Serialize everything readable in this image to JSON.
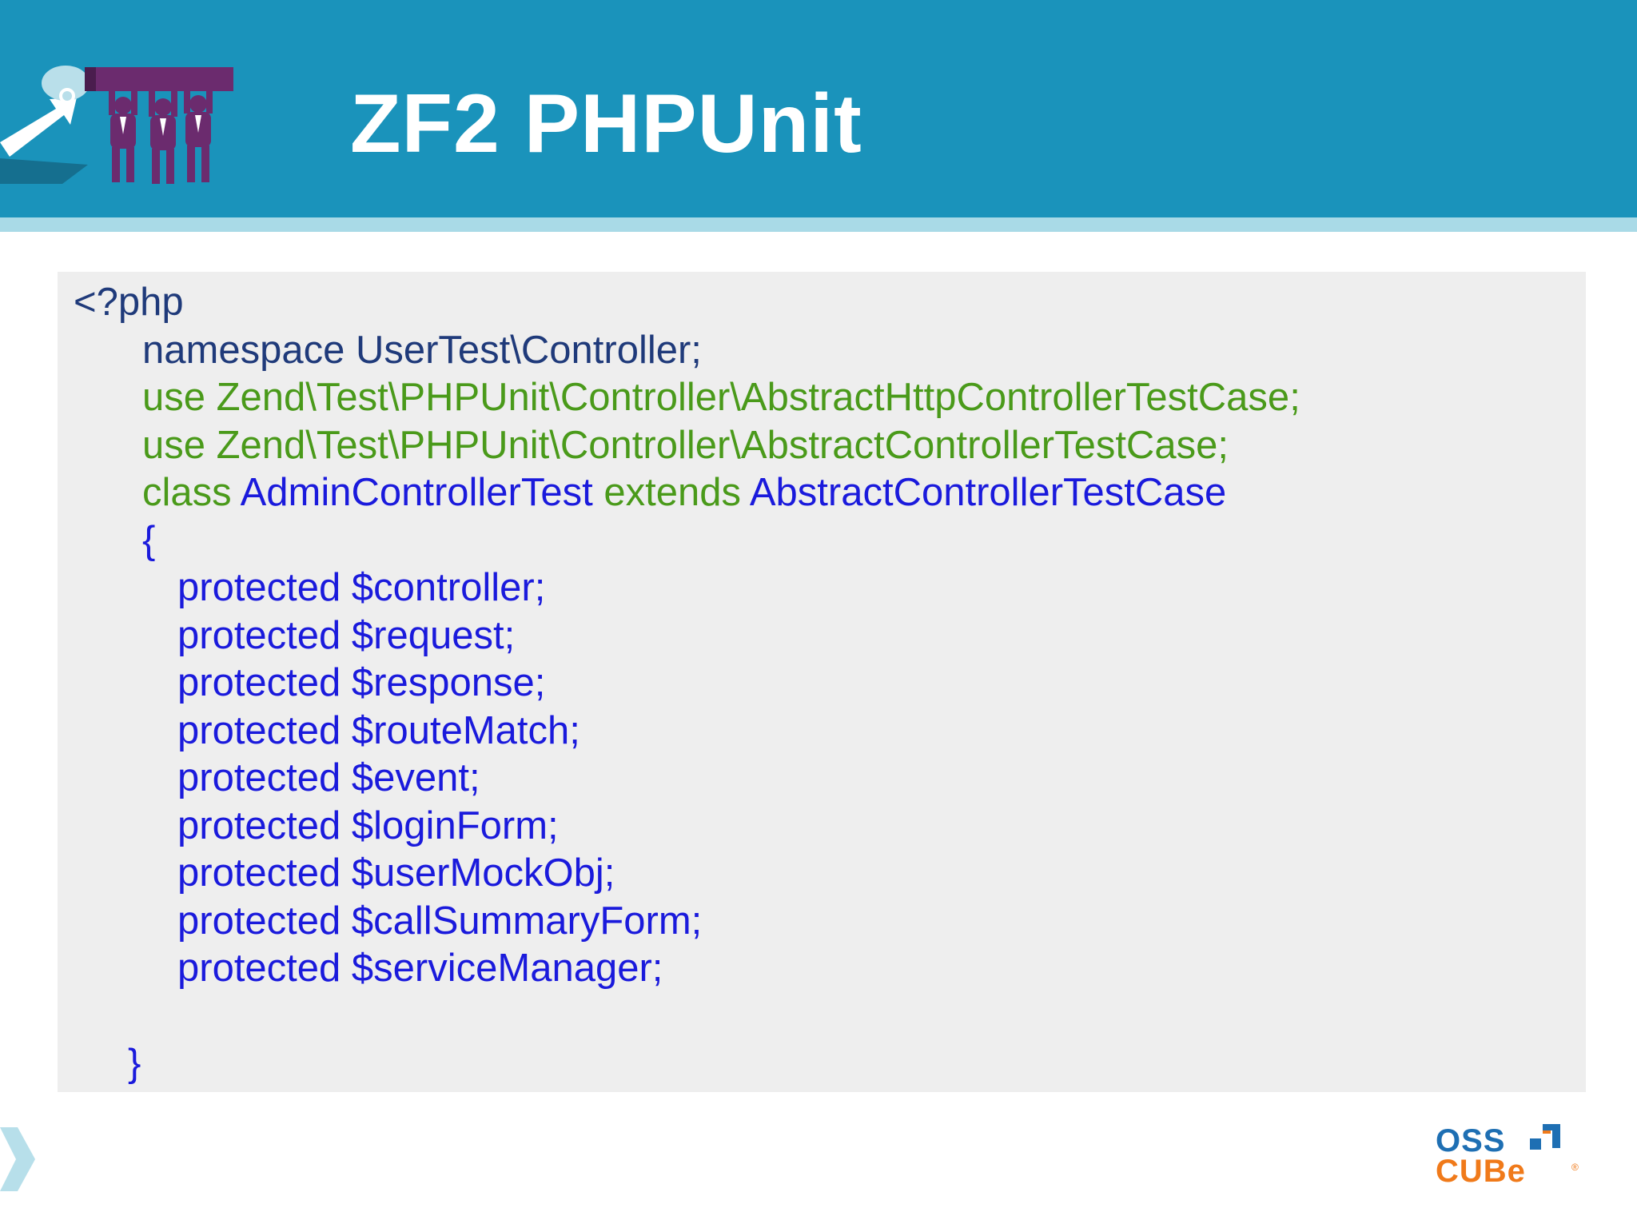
{
  "slide": {
    "title": "ZF2 PHPUnit"
  },
  "logo": {
    "alt": "OSS CUBE"
  },
  "code": {
    "lines": [
      {
        "segments": [
          {
            "text": "<?php",
            "color": "navy"
          }
        ]
      },
      {
        "segments": [
          {
            "text": "namespace UserTest\\Controller;",
            "color": "navy"
          }
        ]
      },
      {
        "segments": [
          {
            "text": "use Zend\\Test\\PHPUnit\\Controller\\AbstractHttpControllerTestCase;",
            "color": "green"
          }
        ]
      },
      {
        "segments": [
          {
            "text": "use Zend\\Test\\PHPUnit\\Controller\\AbstractControllerTestCase;",
            "color": "green"
          }
        ]
      },
      {
        "segments": [
          {
            "text": "class ",
            "color": "green"
          },
          {
            "text": "AdminControllerTest ",
            "color": "blue"
          },
          {
            "text": "extends ",
            "color": "green"
          },
          {
            "text": "AbstractControllerTestCase",
            "color": "blue"
          }
        ]
      },
      {
        "segments": [
          {
            "text": "{",
            "color": "blue"
          }
        ]
      },
      {
        "segments": [
          {
            "text": "protected $controller;",
            "color": "blue"
          }
        ]
      },
      {
        "segments": [
          {
            "text": "protected $request;",
            "color": "blue"
          }
        ]
      },
      {
        "segments": [
          {
            "text": "protected $response;",
            "color": "blue"
          }
        ]
      },
      {
        "segments": [
          {
            "text": "protected $routeMatch;",
            "color": "blue"
          }
        ]
      },
      {
        "segments": [
          {
            "text": "protected $event;",
            "color": "blue"
          }
        ]
      },
      {
        "segments": [
          {
            "text": "protected $loginForm;",
            "color": "blue"
          }
        ]
      },
      {
        "segments": [
          {
            "text": "protected $userMockObj;",
            "color": "blue"
          }
        ]
      },
      {
        "segments": [
          {
            "text": "protected $callSummaryForm;",
            "color": "blue"
          }
        ]
      },
      {
        "segments": [
          {
            "text": "protected $serviceManager;",
            "color": "blue"
          }
        ]
      },
      {
        "segments": []
      },
      {
        "segments": [
          {
            "text": "}",
            "color": "blue"
          }
        ]
      }
    ]
  },
  "colors": {
    "header": "#1a93bb",
    "header_stripe": "#a9dae7",
    "code_background": "#eeeeee",
    "code_navy": "#1f3a7a",
    "code_green": "#4a9a1a",
    "code_blue": "#1a1adc",
    "logo_blue": "#1e6fb3",
    "logo_orange": "#f07a1a"
  }
}
